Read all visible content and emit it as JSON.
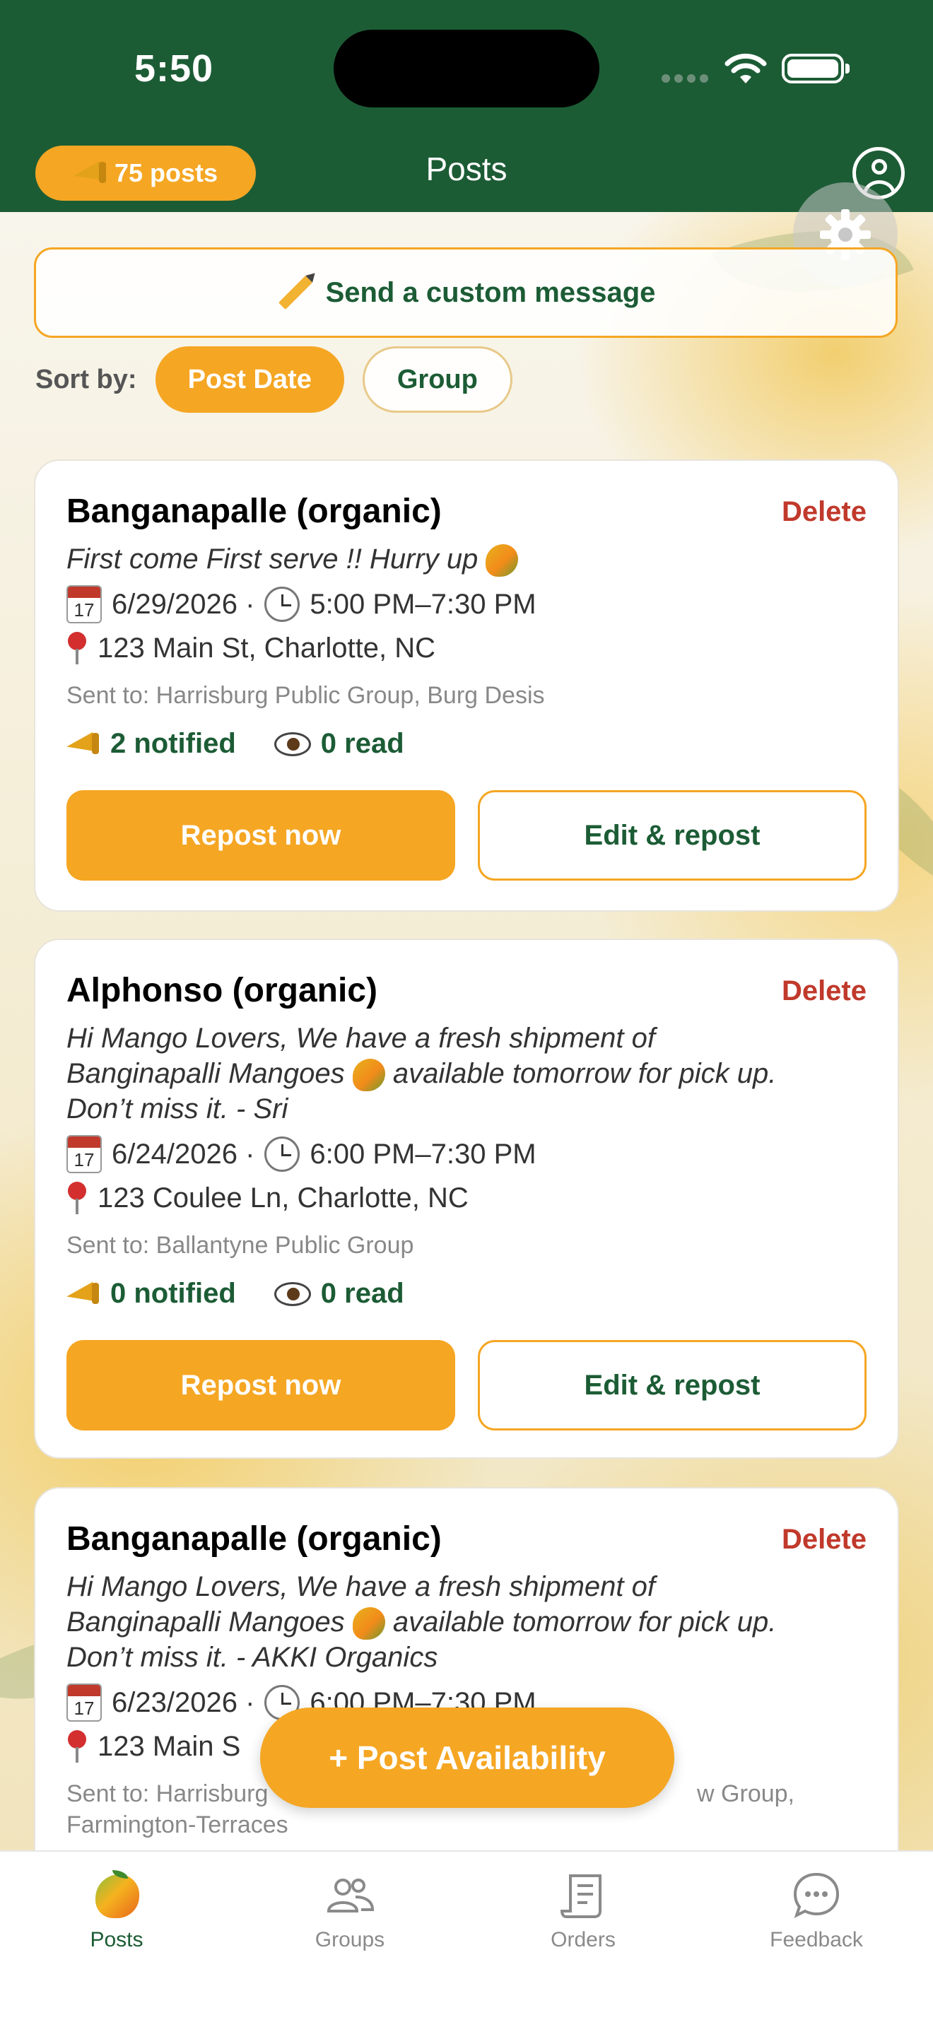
{
  "status_bar": {
    "time": "5:50"
  },
  "header": {
    "title": "Posts",
    "posts_badge": "75 posts"
  },
  "custom_message": {
    "label": "Send a custom message"
  },
  "sort": {
    "label": "Sort by:",
    "options": [
      "Post Date",
      "Group"
    ],
    "selected": "Post Date"
  },
  "posts": [
    {
      "title": "Banganapalle (organic)",
      "delete_label": "Delete",
      "description": "First come First serve !! Hurry up",
      "date": "6/29/2026 ·",
      "time": "5:00 PM–7:30 PM",
      "address": "123 Main St, Charlotte, NC",
      "sent_to": "Sent to: Harrisburg Public Group, Burg Desis",
      "notified": "2 notified",
      "read": "0 read",
      "repost_label": "Repost now",
      "edit_label": "Edit & repost"
    },
    {
      "title": "Alphonso (organic)",
      "delete_label": "Delete",
      "description_lines": [
        "Hi Mango Lovers, We have a fresh shipment of",
        "Banginapalli Mangoes",
        "available tomorrow for pick up.",
        "Don’t miss it. - Sri"
      ],
      "date": "6/24/2026 ·",
      "time": "6:00 PM–7:30 PM",
      "address": "123 Coulee Ln, Charlotte, NC",
      "sent_to": "Sent to: Ballantyne Public Group",
      "notified": "0 notified",
      "read": "0 read",
      "repost_label": "Repost now",
      "edit_label": "Edit & repost"
    },
    {
      "title": "Banganapalle (organic)",
      "delete_label": "Delete",
      "description_lines": [
        "Hi Mango Lovers, We have a fresh shipment of",
        "Banginapalli Mangoes",
        "available tomorrow for pick up.",
        "Don’t miss it. - AKKI Organics"
      ],
      "date": "6/23/2026 ·",
      "time": "6:00 PM–7:30 PM",
      "address": "123 Main S",
      "sent_to_start": "Sent to: Harrisburg",
      "sent_to_end": "w Group,",
      "sent_to_line2": "Farmington-Terraces"
    }
  ],
  "fab": {
    "label": "+ Post Availability"
  },
  "tabbar": {
    "items": [
      {
        "label": "Posts",
        "icon": "mango-icon",
        "active": true
      },
      {
        "label": "Groups",
        "icon": "groups-icon",
        "active": false
      },
      {
        "label": "Orders",
        "icon": "orders-icon",
        "active": false
      },
      {
        "label": "Feedback",
        "icon": "feedback-icon",
        "active": false
      }
    ]
  },
  "colors": {
    "brand_green": "#1c5c35",
    "accent_orange": "#f5a623",
    "delete_red": "#c0392b"
  }
}
